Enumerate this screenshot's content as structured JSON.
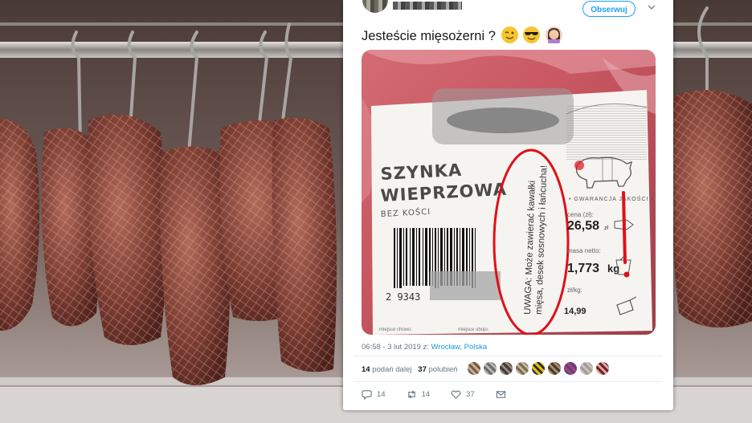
{
  "tweet": {
    "follow_label": "Obserwuj",
    "caret_icon": "chevron-down-icon",
    "text": "Jesteście mięsożerni ? ",
    "emojis": [
      "winking-face-icon",
      "smiling-face-with-sunglasses-icon",
      "woman-facepalming-icon"
    ],
    "meta": {
      "time_date": "06:58 - 3 lut 2019 z: ",
      "location": "Wrocław, Polska"
    },
    "stats": {
      "retweets_count": "14",
      "retweets_label": " podań dalej",
      "likes_count": "37",
      "likes_label": " polubień"
    },
    "actions": {
      "reply_count": "14",
      "retweet_count": "14",
      "like_count": "37"
    }
  },
  "label": {
    "product_line1": "SZYNKA",
    "product_line2": "WIEPRZOWA",
    "product_sub": "BEZ KOŚCI",
    "guarantee": "• GWARANCJA JAKOŚCI •",
    "price_label": "cena (zł):",
    "price_value": "26,58",
    "price_unit": "zł",
    "weight_label": "masa netto:",
    "weight_value": "1,773",
    "weight_unit": "kg",
    "per_kg_label": "zł/kg:",
    "per_kg_value": "14,99",
    "warning_line1": "UWAGA: Może zawierać kawałki",
    "warning_line2": "mięsa, desek sosnowych i łańcucha!",
    "barcode_digits": "2 9343",
    "exclamation": "!",
    "footer_left": "miejsce chowu:",
    "footer_mid": "miejsce uboju:"
  },
  "colors": {
    "twitter_blue": "#1da1f2",
    "link_blue": "#1b95e0",
    "annotation_red": "#e0101a"
  }
}
